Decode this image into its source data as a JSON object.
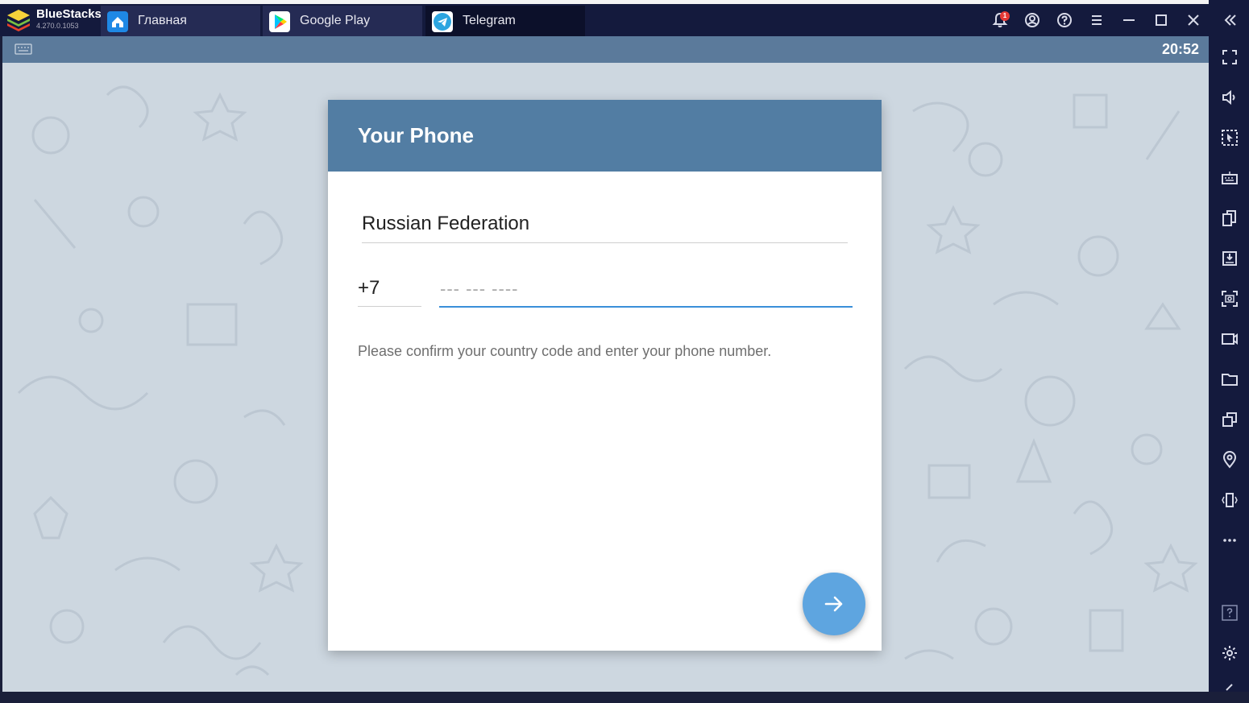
{
  "app": {
    "name": "BlueStacks",
    "version": "4.270.0.1053"
  },
  "tabs": [
    {
      "label": "Главная",
      "icon": "home-icon",
      "color": "#1e88e5"
    },
    {
      "label": "Google Play",
      "icon": "google-play-icon",
      "color": "#ffffff"
    },
    {
      "label": "Telegram",
      "icon": "telegram-icon",
      "color": "#2ca5e0"
    }
  ],
  "notifications": {
    "count": "1"
  },
  "statusbar": {
    "time": "20:52"
  },
  "login": {
    "title": "Your Phone",
    "country": "Russian Federation",
    "country_code": "+7",
    "phone_placeholder": "--- --- ----",
    "hint": "Please confirm your country code and enter your phone number."
  },
  "colors": {
    "header": "#527da3",
    "accent": "#3a8fd9",
    "fab": "#5ea5e0",
    "chrome": "#141a3d",
    "wallpaper": "#cdd7e0"
  }
}
